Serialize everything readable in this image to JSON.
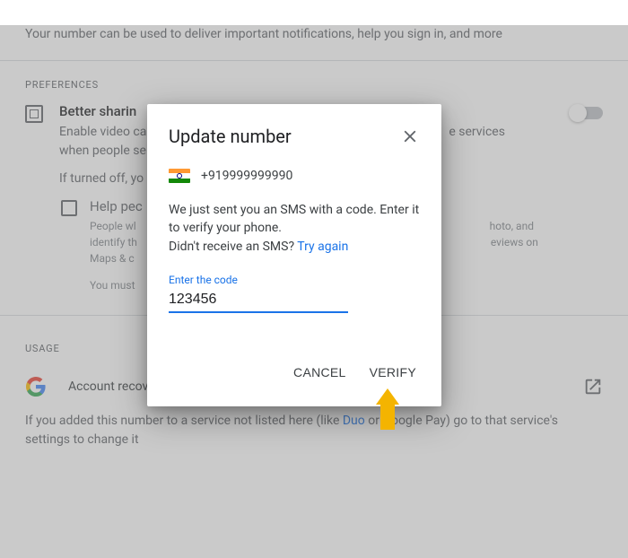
{
  "header": {
    "subtext": "Your number can be used to deliver important notifications, help you sign in, and more"
  },
  "preferences": {
    "label": "PREFERENCES",
    "item": {
      "title": "Better sharin",
      "desc_left": "Enable video ca",
      "desc_right": "e services",
      "desc2": "when people se",
      "off_text": "If turned off, yo"
    },
    "help": {
      "title": "Help pec",
      "line1_left": "People wl",
      "line1_right": "hoto, and",
      "line2_left": "identify th",
      "line2_right": "eviews on",
      "line3": "Maps & c",
      "note": "You must"
    }
  },
  "usage": {
    "label": "USAGE",
    "item_label": "Account recovery",
    "note_before": "If you added this number to a service not listed here (like ",
    "note_link1": "Duo",
    "note_mid": " or Google Pay) go to that service's settings to change it"
  },
  "dialog": {
    "title": "Update number",
    "phone": "+919999999990",
    "msg_line1": "We just sent you an SMS with a code. Enter it to verify your phone.",
    "msg_line2_before": "Didn't receive an SMS? ",
    "msg_link": "Try again",
    "code_label": "Enter the code",
    "code_value": "123456",
    "cancel": "CANCEL",
    "verify": "VERIFY"
  }
}
